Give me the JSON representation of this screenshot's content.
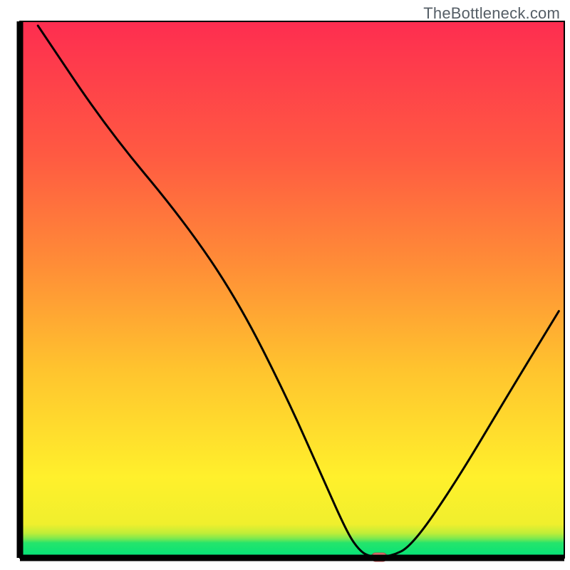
{
  "watermark": "TheBottleneck.com",
  "chart_data": {
    "type": "line",
    "title": "",
    "xlabel": "",
    "ylabel": "",
    "xlim": [
      0,
      100
    ],
    "ylim": [
      0,
      100
    ],
    "x_axis_visible": true,
    "y_axis_visible": true,
    "background_gradient": [
      {
        "pos": 0,
        "color": "#00e27a"
      },
      {
        "pos": 2.8,
        "color": "#25e46b"
      },
      {
        "pos": 3.6,
        "color": "#7de94f"
      },
      {
        "pos": 4.6,
        "color": "#c0ed38"
      },
      {
        "pos": 6.3,
        "color": "#f0ef2d"
      },
      {
        "pos": 15,
        "color": "#fff02c"
      },
      {
        "pos": 35,
        "color": "#ffc42e"
      },
      {
        "pos": 55,
        "color": "#ff8c37"
      },
      {
        "pos": 75,
        "color": "#ff5a42"
      },
      {
        "pos": 100,
        "color": "#fe2d50"
      }
    ],
    "series": [
      {
        "name": "bottleneck-curve",
        "color": "#000000",
        "points": [
          {
            "x": 3.3,
            "y": 99.2
          },
          {
            "x": 16.0,
            "y": 80.0
          },
          {
            "x": 30.0,
            "y": 63.0
          },
          {
            "x": 40.0,
            "y": 48.0
          },
          {
            "x": 49.0,
            "y": 30.0
          },
          {
            "x": 56.0,
            "y": 14.0
          },
          {
            "x": 60.0,
            "y": 5.0
          },
          {
            "x": 62.0,
            "y": 1.8
          },
          {
            "x": 64.0,
            "y": 0.2
          },
          {
            "x": 68.0,
            "y": 0.2
          },
          {
            "x": 72.0,
            "y": 2.2
          },
          {
            "x": 80.0,
            "y": 14.0
          },
          {
            "x": 90.0,
            "y": 31.0
          },
          {
            "x": 99.0,
            "y": 46.0
          }
        ]
      }
    ],
    "marker": {
      "name": "optimal-point",
      "x": 66.0,
      "y": 0.0,
      "color": "#e57373",
      "stroke": "#b04a4a"
    },
    "plot_box_color": "#000000"
  }
}
